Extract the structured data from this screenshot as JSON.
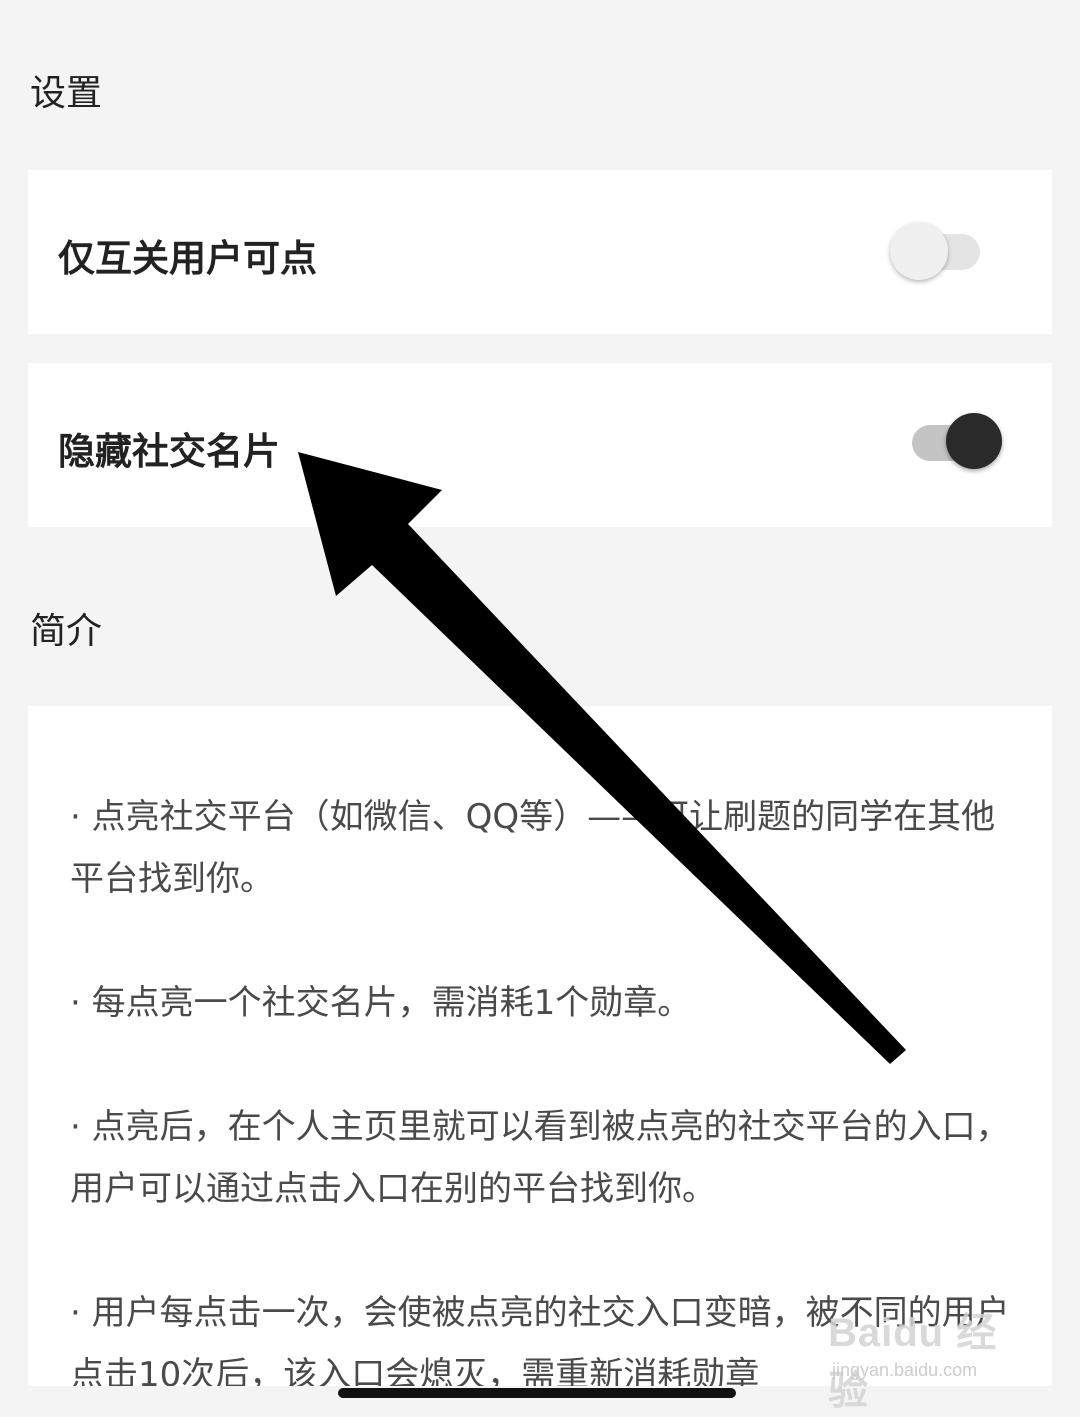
{
  "settings": {
    "section_title": "设置",
    "rows": [
      {
        "label": "仅互关用户可点",
        "toggle_on": false
      },
      {
        "label": "隐藏社交名片",
        "toggle_on": true
      }
    ]
  },
  "intro": {
    "section_title": "简介",
    "paragraphs": [
      "· 点亮社交平台（如微信、QQ等）——可让刷题的同学在其他平台找到你。",
      "· 每点亮一个社交名片，需消耗1个勋章。",
      "· 点亮后，在个人主页里就可以看到被点亮的社交平台的入口，用户可以通过点击入口在别的平台找到你。",
      "· 用户每点击一次，会使被点亮的社交入口变暗，被不同的用户点击10次后，该入口会熄灭，需重新消耗勋章"
    ]
  },
  "watermark": {
    "logo": "Baidu 经验",
    "url": "jingyan.baidu.com"
  },
  "colors": {
    "background": "#f4f4f4",
    "card": "#ffffff",
    "toggle_on_knob": "#2a2a2a",
    "toggle_off_knob": "#f0f0f0",
    "arrow": "#000000"
  }
}
